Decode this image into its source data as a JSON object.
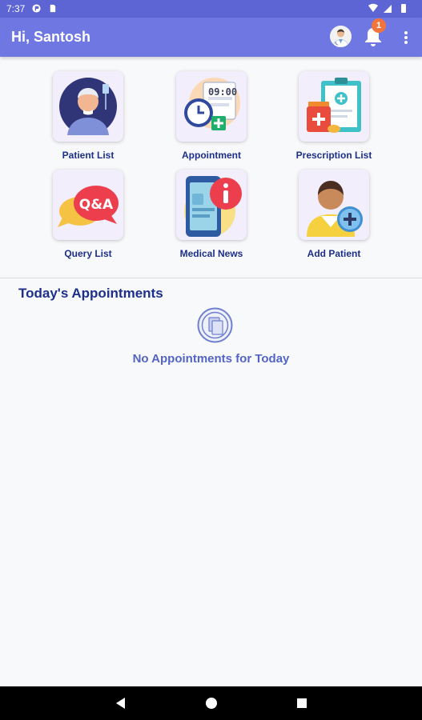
{
  "status_bar": {
    "time": "7:37"
  },
  "header": {
    "greeting": "Hi, Santosh",
    "notification_count": "1"
  },
  "tiles": [
    {
      "label": "Patient List",
      "icon": "patient-icon"
    },
    {
      "label": "Appointment",
      "icon": "appointment-icon"
    },
    {
      "label": "Prescription List",
      "icon": "prescription-icon"
    },
    {
      "label": "Query List",
      "icon": "qa-icon"
    },
    {
      "label": "Medical News",
      "icon": "medical-news-icon"
    },
    {
      "label": "Add Patient",
      "icon": "add-patient-icon"
    }
  ],
  "qa_text": "Q&A",
  "clock_text": "09:00",
  "appointments": {
    "title": "Today's Appointments",
    "empty_message": "No Appointments for Today"
  },
  "colors": {
    "app_bar": "#6f77e2",
    "status_bar": "#5d65d4",
    "accent_text": "#1d2f8a",
    "badge": "#f0743b"
  }
}
